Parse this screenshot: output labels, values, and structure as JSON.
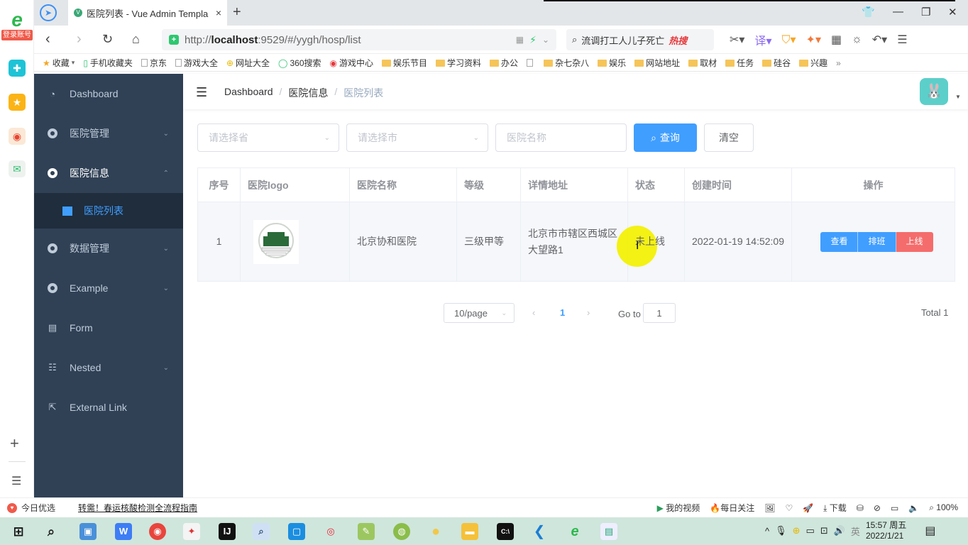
{
  "browser": {
    "rail": {
      "login_label": "登录账号",
      "icons": [
        "browser-logo-icon",
        "app-store-icon",
        "favorites-star-icon",
        "weibo-icon",
        "mail-icon"
      ],
      "add_icon": "plus-icon",
      "list_icon": "list-icon"
    },
    "tab": {
      "title": "医院列表 - Vue Admin Templa",
      "favicon": "V",
      "close": "×",
      "new_tab": "+"
    },
    "window_controls": {
      "skin": "👕",
      "minimize": "—",
      "restore": "❐",
      "close": "✕"
    },
    "address": {
      "scheme": "http://",
      "host": "localhost",
      "rest": ":9529/#/yygh/hosp/list",
      "shield": "+"
    },
    "search": {
      "text": "流调打工人儿子死亡",
      "hot_label": "热搜"
    },
    "bookmarks": [
      {
        "label": "收藏",
        "icon": "star"
      },
      {
        "label": "手机收藏夹",
        "icon": "phone"
      },
      {
        "label": "京东",
        "icon": "doc"
      },
      {
        "label": "游戏大全",
        "icon": "doc"
      },
      {
        "label": "网址大全",
        "icon": "site"
      },
      {
        "label": "360搜索",
        "icon": "search360"
      },
      {
        "label": "游戏中心",
        "icon": "game"
      },
      {
        "label": "娱乐节目",
        "icon": "folder"
      },
      {
        "label": "学习资料",
        "icon": "folder"
      },
      {
        "label": "办公",
        "icon": "folder"
      },
      {
        "label": "",
        "icon": "doc"
      },
      {
        "label": "杂七杂八",
        "icon": "folder"
      },
      {
        "label": "娱乐",
        "icon": "folder"
      },
      {
        "label": "网站地址",
        "icon": "folder"
      },
      {
        "label": "取材",
        "icon": "folder"
      },
      {
        "label": "任务",
        "icon": "folder"
      },
      {
        "label": "硅谷",
        "icon": "folder"
      },
      {
        "label": "兴趣",
        "icon": "folder"
      }
    ],
    "bookmarks_more": "»"
  },
  "sidebar": {
    "items": [
      {
        "label": "Dashboard",
        "icon": "dashboard-icon",
        "has_arrow": false
      },
      {
        "label": "医院管理",
        "icon": "ring-icon",
        "has_arrow": true,
        "arrow": "⌄"
      },
      {
        "label": "医院信息",
        "icon": "ring-icon",
        "has_arrow": true,
        "arrow": "⌃",
        "open": true
      },
      {
        "label": "数据管理",
        "icon": "ring-icon",
        "has_arrow": true,
        "arrow": "⌄"
      },
      {
        "label": "Example",
        "icon": "ring-icon",
        "has_arrow": true,
        "arrow": "⌄"
      },
      {
        "label": "Form",
        "icon": "form-icon",
        "has_arrow": false
      },
      {
        "label": "Nested",
        "icon": "nested-icon",
        "has_arrow": true,
        "arrow": "⌄"
      },
      {
        "label": "External Link",
        "icon": "external-link-icon",
        "has_arrow": false
      }
    ],
    "active_sub": {
      "label": "医院列表"
    }
  },
  "header": {
    "breadcrumb": [
      "Dashboard",
      "医院信息",
      "医院列表"
    ],
    "separator": "/"
  },
  "filters": {
    "province_placeholder": "请选择省",
    "city_placeholder": "请选择市",
    "name_placeholder": "医院名称",
    "query_label": "查询",
    "clear_label": "清空"
  },
  "table": {
    "columns": [
      "序号",
      "医院logo",
      "医院名称",
      "等级",
      "详情地址",
      "状态",
      "创建时间",
      "操作"
    ],
    "rows": [
      {
        "index": "1",
        "name": "北京协和医院",
        "level": "三级甲等",
        "address_line1": "北京市市辖区西城区",
        "address_line2": "大望路1",
        "status": "未上线",
        "created": "2022-01-19 14:52:09",
        "actions": [
          "查看",
          "排班",
          "上线"
        ]
      }
    ]
  },
  "pagination": {
    "page_size": "10/page",
    "prev": "‹",
    "current": "1",
    "next": "›",
    "goto_label": "Go to",
    "goto_value": "1",
    "total": "Total 1"
  },
  "statusbar": {
    "left_label": "今日优选",
    "news": "转需！春运核酸检测全流程指南",
    "video": "我的视频",
    "daily": "每日关注",
    "download": "下载",
    "zoom": "100%"
  },
  "taskbar": {
    "time": "15:57 周五",
    "date": "2022/1/21",
    "ime": "英"
  },
  "colors": {
    "primary": "#409eff",
    "danger": "#f56c6c",
    "sidebar_bg": "#304156",
    "sidebar_sub_bg": "#1f2d3d"
  }
}
